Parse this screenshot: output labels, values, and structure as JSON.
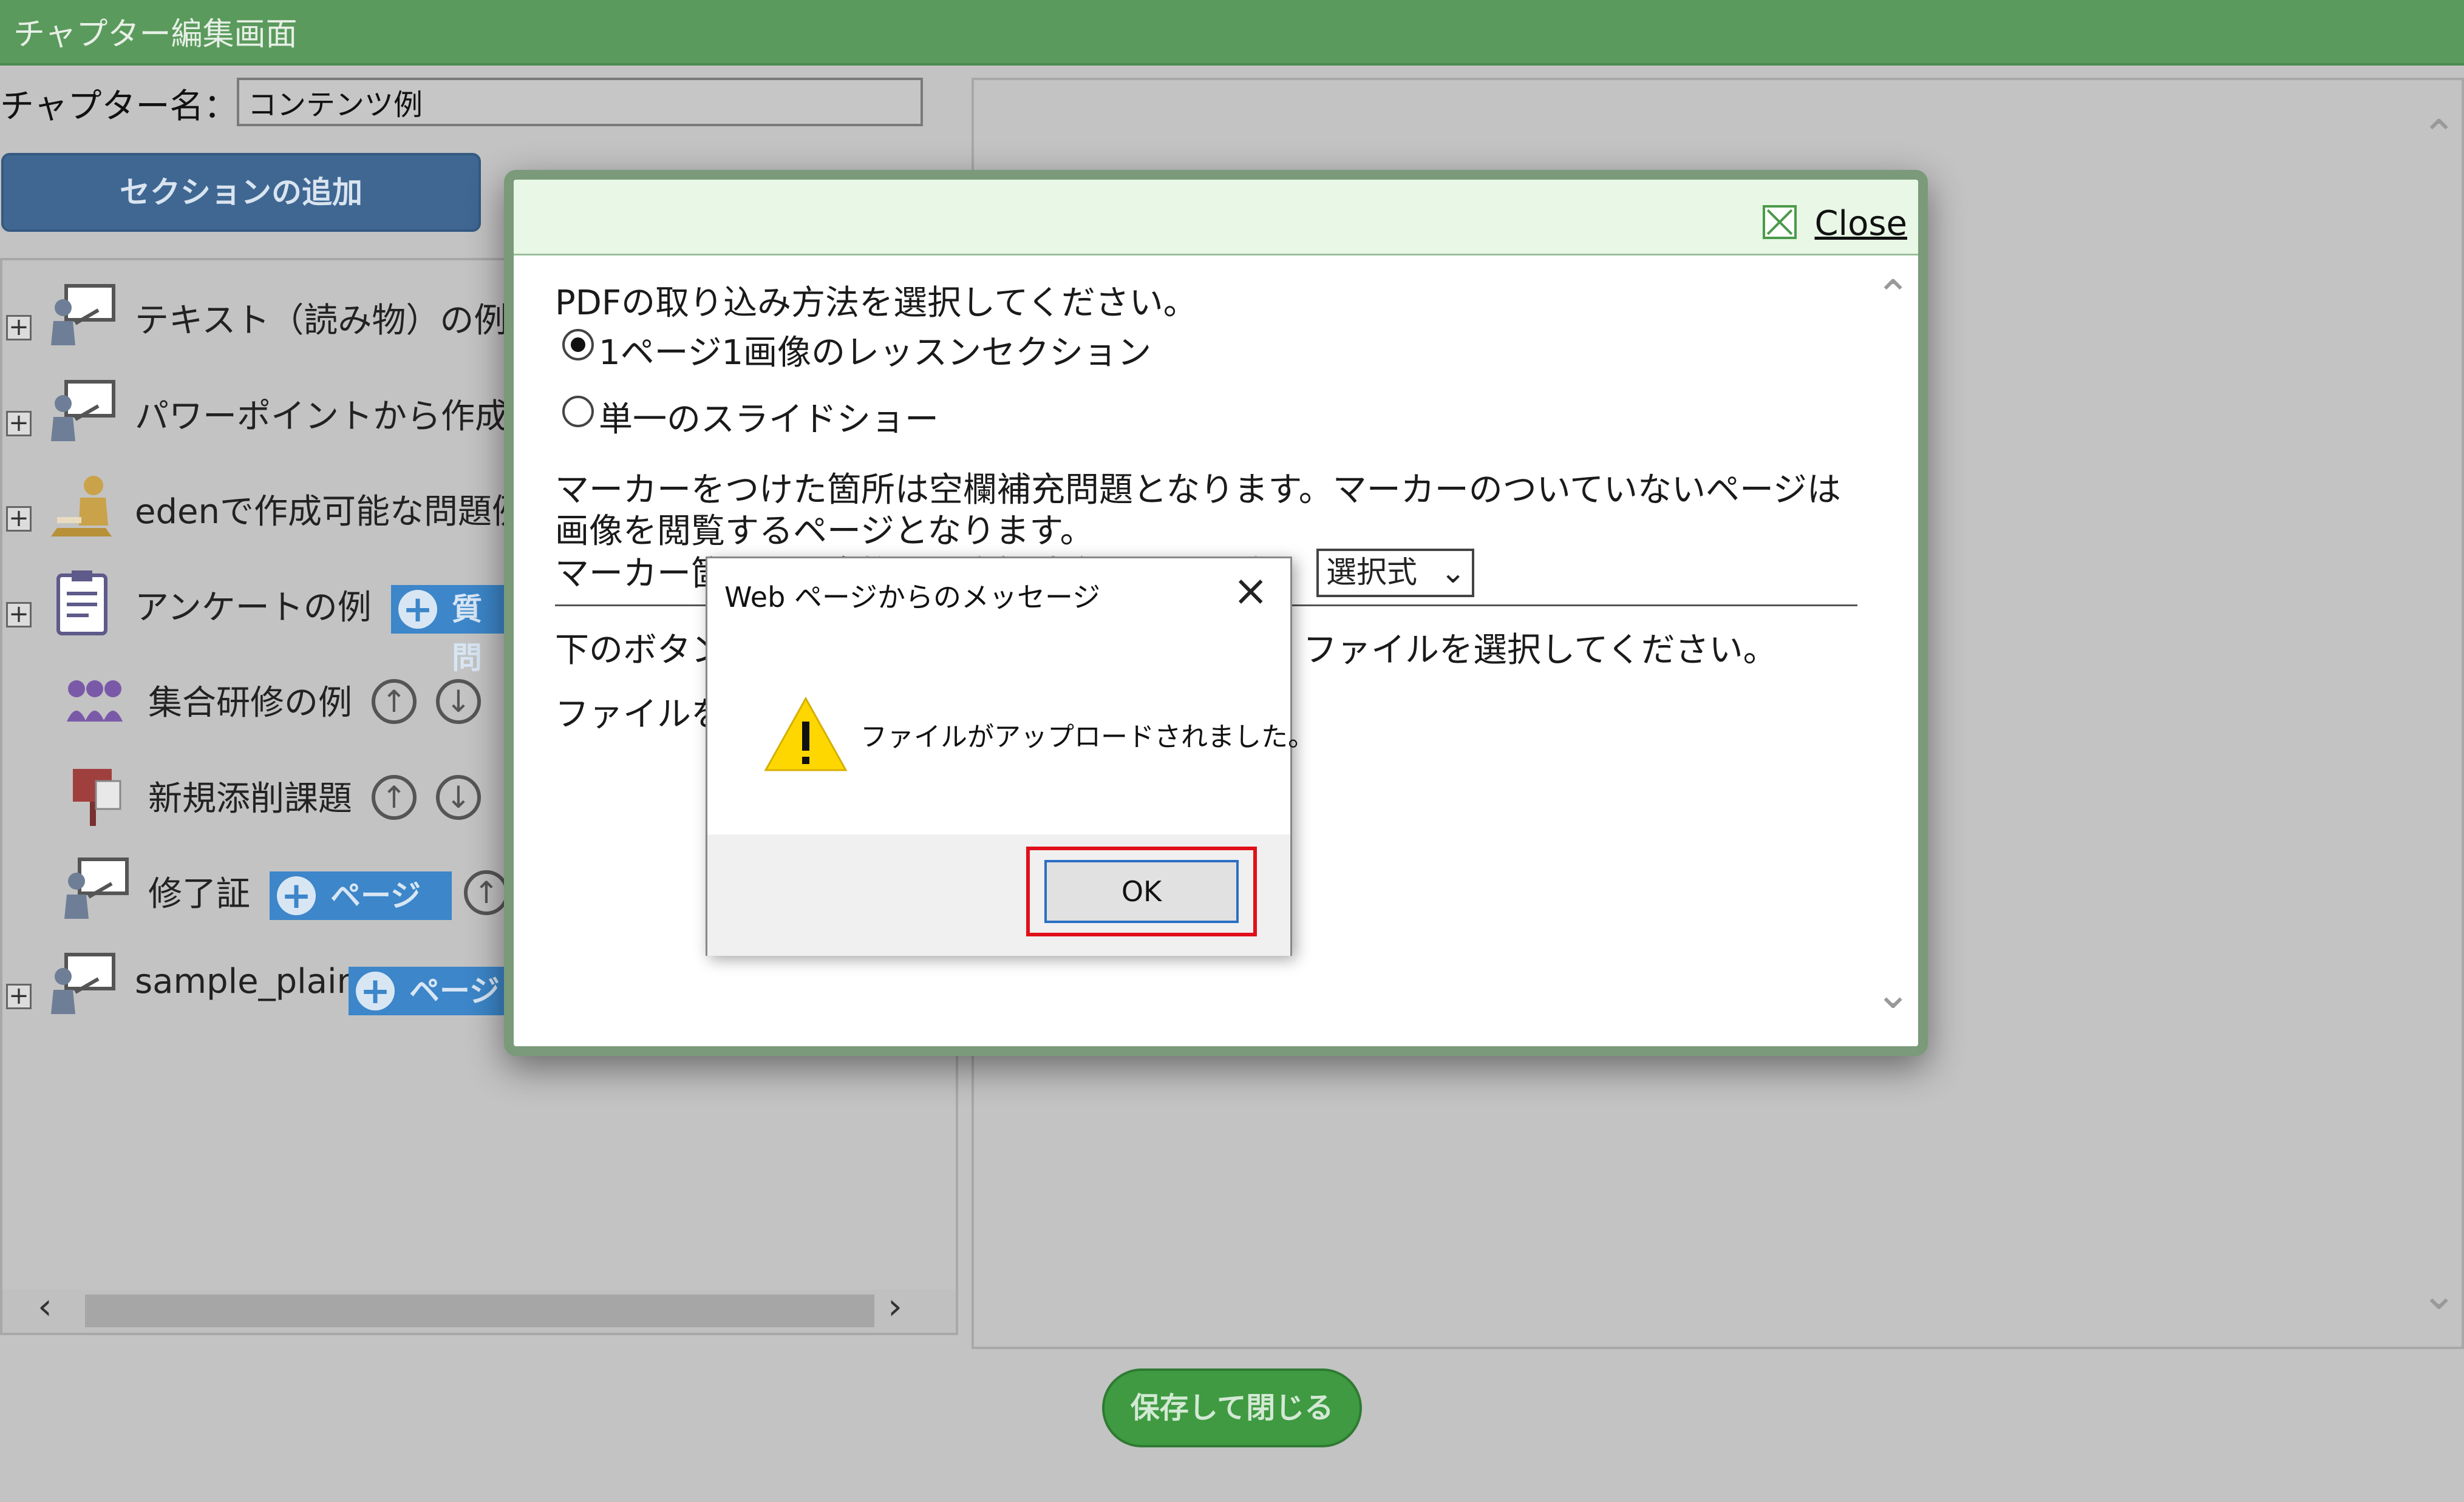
{
  "header": {
    "title": "チャプター編集画面"
  },
  "chapter": {
    "label": "チャプター名：",
    "value": "コンテンツ例"
  },
  "add_section_button": "セクションの追加",
  "tree": {
    "rows": [
      {
        "label": "テキスト（読み物）の例"
      },
      {
        "label": "パワーポイントから作成"
      },
      {
        "label": "edenで作成可能な問題例"
      },
      {
        "label": "アンケートの例",
        "button": "質問"
      },
      {
        "label": "集合研修の例"
      },
      {
        "label": "新規添削課題"
      },
      {
        "label": "修了証",
        "button": "ページ"
      },
      {
        "label": "sample_plain",
        "button": "ページ"
      }
    ]
  },
  "save_button": "保存して閉じる",
  "modal": {
    "close_label": "Close",
    "prompt": "PDFの取り込み方法を選択してください。",
    "option1": "1ページ1画像のレッスンセクション",
    "option2": "単一のスライドショー",
    "desc_line1": "マーカーをつけた箇所は空欄補充問題となります。マーカーのついていないページは",
    "desc_line2": "画像を閲覧するページとなります。",
    "desc_line3": "マーカー箇所から変換した空欄補充問題の形式",
    "select_value": "選択式",
    "upload_line_left": "下のボタン",
    "upload_line_right": "ファイルを選択してください。",
    "file_line": "ファイルを"
  },
  "alert": {
    "title": "Web ページからのメッセージ",
    "message": "ファイルがアップロードされました。",
    "ok": "OK"
  }
}
